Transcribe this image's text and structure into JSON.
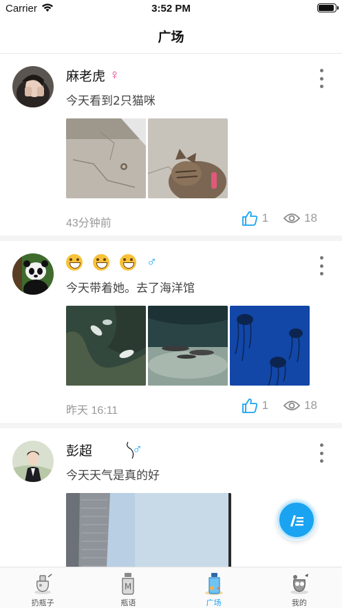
{
  "status_bar": {
    "carrier": "Carrier",
    "time": "3:52 PM"
  },
  "nav": {
    "title": "广场"
  },
  "posts": [
    {
      "name": "麻老虎",
      "gender_symbol": "♀",
      "gender_color": "#e8348c",
      "text": "今天看到2只猫咪",
      "time": "43分钟前",
      "likes": "1",
      "views": "18"
    },
    {
      "name": "",
      "gender_symbol": "♂",
      "gender_color": "#1aa3f0",
      "text": "今天带着她。去了海洋馆",
      "time": "昨天 16:11",
      "likes": "1",
      "views": "18"
    },
    {
      "name": "彭超",
      "gender_symbol": "♂",
      "gender_color": "#1aa3f0",
      "text": "今天天气是真的好",
      "time": "",
      "likes": "",
      "views": ""
    }
  ],
  "tabs": [
    {
      "label": "扔瓶子"
    },
    {
      "label": "瓶语"
    },
    {
      "label": "广场"
    },
    {
      "label": "我的"
    }
  ],
  "colors": {
    "accent": "#1aa3f0",
    "female": "#e8348c"
  }
}
